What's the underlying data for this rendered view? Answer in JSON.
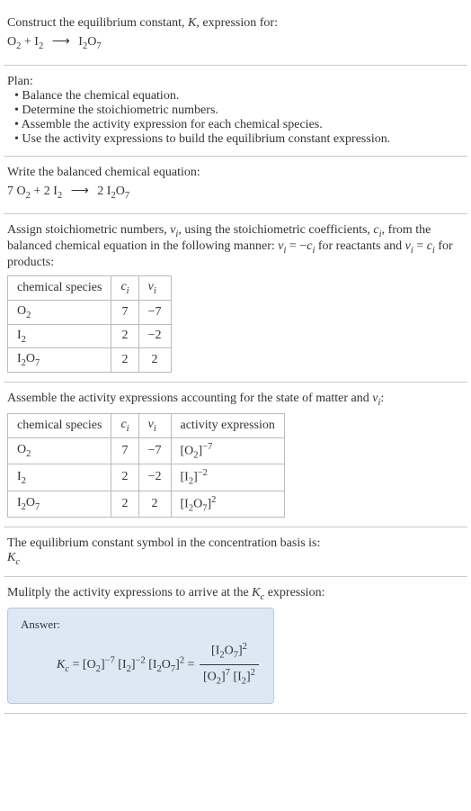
{
  "header": {
    "line1": "Construct the equilibrium constant, ",
    "Ksym": "K",
    "line1b": ", expression for:",
    "eq_unbalanced_lhs1": "O",
    "eq_unbalanced_lhs1sub": "2",
    "plus": " + ",
    "eq_unbalanced_lhs2": "I",
    "eq_unbalanced_lhs2sub": "2",
    "arrow": "⟶",
    "eq_unbalanced_rhs": "I",
    "eq_unbalanced_rhs_sub1": "2",
    "eq_unbalanced_rhs_mid": "O",
    "eq_unbalanced_rhs_sub2": "7"
  },
  "plan": {
    "title": "Plan:",
    "b1": "• Balance the chemical equation.",
    "b2": "• Determine the stoichiometric numbers.",
    "b3": "• Assemble the activity expression for each chemical species.",
    "b4": "• Use the activity expressions to build the equilibrium constant expression."
  },
  "balanced": {
    "title": "Write the balanced chemical equation:",
    "c1": "7 O",
    "c1sub": "2",
    "plus": " + 2 I",
    "c2sub": "2",
    "arrow": "⟶",
    "rhs": " 2 I",
    "rhs_sub1": "2",
    "rhs_mid": "O",
    "rhs_sub2": "7"
  },
  "stoich": {
    "intro1": "Assign stoichiometric numbers, ",
    "nu": "ν",
    "isub": "i",
    "intro2": ", using the stoichiometric coefficients, ",
    "c": "c",
    "intro3": ", from the balanced chemical equation in the following manner: ",
    "rel1a": "ν",
    "rel1b": " = −",
    "rel1c": "c",
    "intro4": " for reactants and ",
    "rel2a": "ν",
    "rel2b": " = ",
    "rel2c": "c",
    "intro5": " for products:",
    "headers": {
      "h1": "chemical species",
      "h2": "c",
      "h3": "ν"
    },
    "rows": [
      {
        "sp": "O",
        "spsub": "2",
        "sp2": "",
        "spsub2": "",
        "c": "7",
        "nu": "−7"
      },
      {
        "sp": "I",
        "spsub": "2",
        "sp2": "",
        "spsub2": "",
        "c": "2",
        "nu": "−2"
      },
      {
        "sp": "I",
        "spsub": "2",
        "sp2": "O",
        "spsub2": "7",
        "c": "2",
        "nu": "2"
      }
    ]
  },
  "activity": {
    "intro1": "Assemble the activity expressions accounting for the state of matter and ",
    "nu": "ν",
    "isub": "i",
    "colon": ":",
    "headers": {
      "h1": "chemical species",
      "h2": "c",
      "h3": "ν",
      "h4": "activity expression"
    },
    "rows": [
      {
        "sp": "O",
        "spsub": "2",
        "sp2": "",
        "spsub2": "",
        "c": "7",
        "nu": "−7",
        "act_base": "[O",
        "act_bsub": "2",
        "act_close": "]",
        "act_exp": "−7"
      },
      {
        "sp": "I",
        "spsub": "2",
        "sp2": "",
        "spsub2": "",
        "c": "2",
        "nu": "−2",
        "act_base": "[I",
        "act_bsub": "2",
        "act_close": "]",
        "act_exp": "−2"
      },
      {
        "sp": "I",
        "spsub": "2",
        "sp2": "O",
        "spsub2": "7",
        "c": "2",
        "nu": "2",
        "act_base": "[I",
        "act_bsub": "2",
        "act_mid": "O",
        "act_bsub2": "7",
        "act_close": "]",
        "act_exp": "2"
      }
    ]
  },
  "symbol": {
    "line": "The equilibrium constant symbol in the concentration basis is:",
    "K": "K",
    "csub": "c"
  },
  "multiply": {
    "line1": "Mulitply the activity expressions to arrive at the ",
    "K": "K",
    "csub": "c",
    "line2": " expression:"
  },
  "answer": {
    "label": "Answer:",
    "K": "K",
    "csub": "c",
    "eq": " = ",
    "t1": "[O",
    "t1sub": "2",
    "t1c": "]",
    "t1exp": "−7",
    "t2": " [I",
    "t2sub": "2",
    "t2c": "]",
    "t2exp": "−2",
    "t3": " [I",
    "t3sub": "2",
    "t3mid": "O",
    "t3sub2": "7",
    "t3c": "]",
    "t3exp": "2",
    "eq2": " = ",
    "num": "[I",
    "numsub": "2",
    "nummid": "O",
    "numsub2": "7",
    "numc": "]",
    "numexp": "2",
    "den1": "[O",
    "den1sub": "2",
    "den1c": "]",
    "den1exp": "7",
    "den2": " [I",
    "den2sub": "2",
    "den2c": "]",
    "den2exp": "2"
  }
}
